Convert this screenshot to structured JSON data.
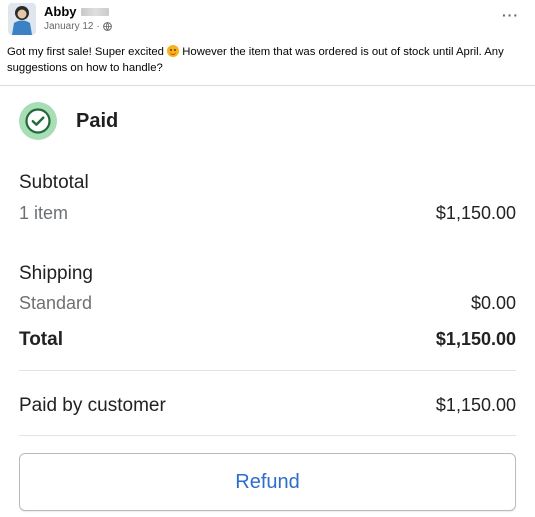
{
  "post": {
    "author": "Abby",
    "date": "January 12",
    "separator": "·",
    "more_label": "···",
    "text_before_emoji": "Got my first sale! Super excited ",
    "text_after_emoji": " However the item that was ordered is out of stock until April. Any suggestions on how to handle?"
  },
  "order": {
    "status": "Paid",
    "subtotal_label": "Subtotal",
    "item_count": "1 item",
    "subtotal_amount": "$1,150.00",
    "shipping_label": "Shipping",
    "shipping_method": "Standard",
    "shipping_amount": "$0.00",
    "total_label": "Total",
    "total_amount": "$1,150.00",
    "paid_label": "Paid by customer",
    "paid_amount": "$1,150.00",
    "refund_label": "Refund"
  },
  "colors": {
    "accent": "#2c6ecb",
    "paid_badge": "#a9ddb6",
    "check": "#1f6b3a"
  },
  "icons": [
    "avatar",
    "globe-icon",
    "more-icon",
    "emoji-icon",
    "check-circle-icon"
  ]
}
